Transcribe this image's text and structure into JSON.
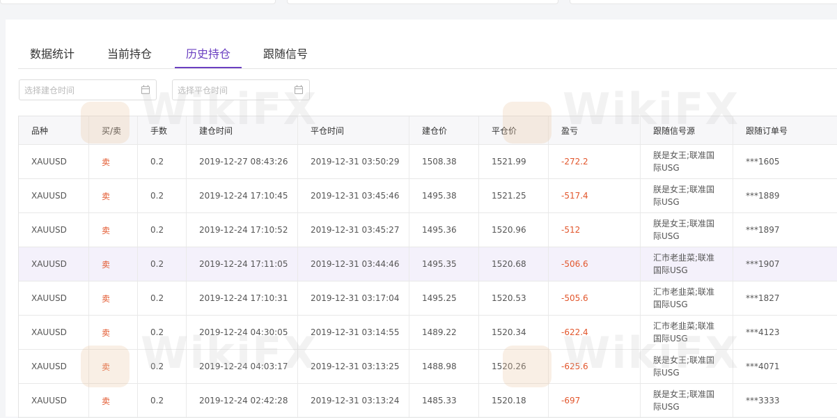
{
  "tabs": [
    {
      "label": "数据统计",
      "active": false
    },
    {
      "label": "当前持仓",
      "active": false
    },
    {
      "label": "历史持仓",
      "active": true
    },
    {
      "label": "跟随信号",
      "active": false
    }
  ],
  "filters": {
    "open_time_placeholder": "选择建仓时间",
    "close_time_placeholder": "选择平仓时间"
  },
  "table": {
    "columns": [
      "品种",
      "买/卖",
      "手数",
      "建仓时间",
      "平仓时间",
      "建仓价",
      "平仓价",
      "盈亏",
      "跟随信号源",
      "跟随订单号"
    ],
    "rows": [
      {
        "symbol": "XAUUSD",
        "side": "卖",
        "lots": "0.2",
        "open_time": "2019-12-27 08:43:26",
        "close_time": "2019-12-31 03:50:29",
        "open_price": "1508.38",
        "close_price": "1521.99",
        "pnl": "-272.2",
        "source": "朕是女王;联准国际USG",
        "order": "***1605"
      },
      {
        "symbol": "XAUUSD",
        "side": "卖",
        "lots": "0.2",
        "open_time": "2019-12-24 17:10:45",
        "close_time": "2019-12-31 03:45:46",
        "open_price": "1495.38",
        "close_price": "1521.25",
        "pnl": "-517.4",
        "source": "朕是女王;联准国际USG",
        "order": "***1889"
      },
      {
        "symbol": "XAUUSD",
        "side": "卖",
        "lots": "0.2",
        "open_time": "2019-12-24 17:10:52",
        "close_time": "2019-12-31 03:45:27",
        "open_price": "1495.36",
        "close_price": "1520.96",
        "pnl": "-512",
        "source": "朕是女王;联准国际USG",
        "order": "***1897"
      },
      {
        "symbol": "XAUUSD",
        "side": "卖",
        "lots": "0.2",
        "open_time": "2019-12-24 17:11:05",
        "close_time": "2019-12-31 03:44:46",
        "open_price": "1495.35",
        "close_price": "1520.68",
        "pnl": "-506.6",
        "source": "汇市老韭菜;联准国际USG",
        "order": "***1907"
      },
      {
        "symbol": "XAUUSD",
        "side": "卖",
        "lots": "0.2",
        "open_time": "2019-12-24 17:10:31",
        "close_time": "2019-12-31 03:17:04",
        "open_price": "1495.25",
        "close_price": "1520.53",
        "pnl": "-505.6",
        "source": "汇市老韭菜;联准国际USG",
        "order": "***1827"
      },
      {
        "symbol": "XAUUSD",
        "side": "卖",
        "lots": "0.2",
        "open_time": "2019-12-24 04:30:05",
        "close_time": "2019-12-31 03:14:55",
        "open_price": "1489.22",
        "close_price": "1520.34",
        "pnl": "-622.4",
        "source": "汇市老韭菜;联准国际USG",
        "order": "***4123"
      },
      {
        "symbol": "XAUUSD",
        "side": "卖",
        "lots": "0.2",
        "open_time": "2019-12-24 04:03:17",
        "close_time": "2019-12-31 03:13:25",
        "open_price": "1488.98",
        "close_price": "1520.26",
        "pnl": "-625.6",
        "source": "朕是女王;联准国际USG",
        "order": "***4071"
      },
      {
        "symbol": "XAUUSD",
        "side": "卖",
        "lots": "0.2",
        "open_time": "2019-12-24 02:42:28",
        "close_time": "2019-12-31 03:13:24",
        "open_price": "1485.33",
        "close_price": "1520.18",
        "pnl": "-697",
        "source": "朕是女王;联准国际USG",
        "order": "***3333"
      }
    ]
  },
  "watermark": "WikiFX",
  "colors": {
    "accent": "#6a3fc1",
    "loss": "#e2562c",
    "row_highlight": "#f4f1fb"
  }
}
